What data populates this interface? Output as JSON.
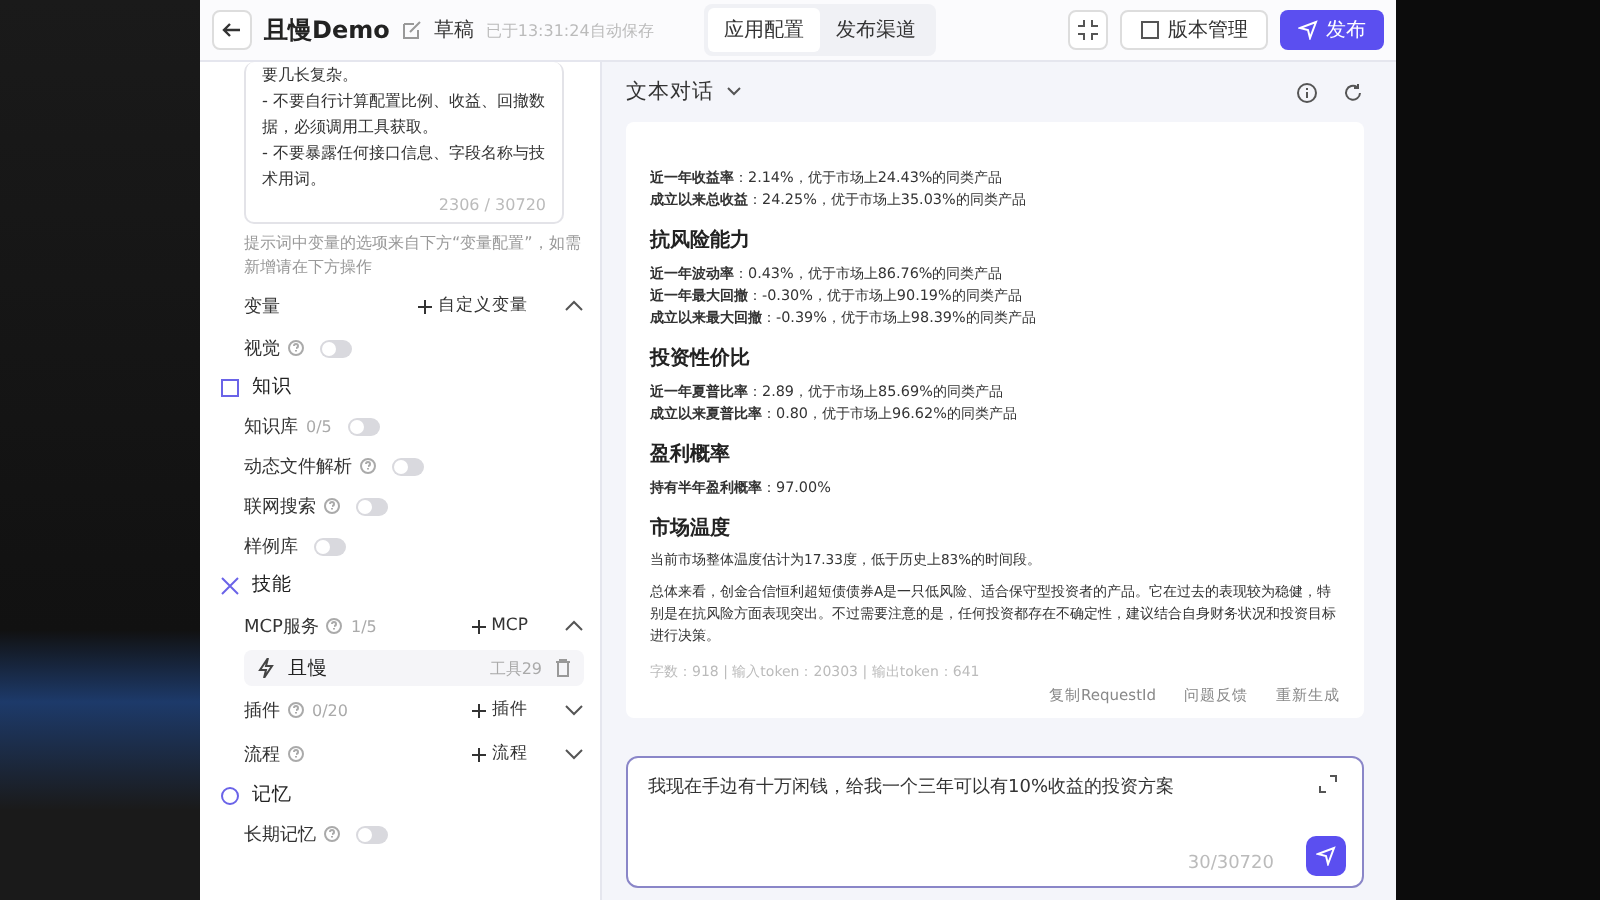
{
  "header": {
    "title": "且慢Demo",
    "badge": "草稿",
    "saved": "已于13:31:24自动保存",
    "tabs": [
      {
        "label": "应用配置",
        "selected": true
      },
      {
        "label": "发布渠道",
        "selected": false
      }
    ],
    "version_button": "版本管理",
    "publish_button": "发布"
  },
  "config": {
    "prompt_lines": [
      "要几长复杂。",
      "- 不要自行计算配置比例、收益、回撤数据，必须调用工具获取。",
      "- 不要暴露任何接口信息、字段名称与技术用词。"
    ],
    "prompt_count": "2306 / 30720",
    "prompt_hint": "提示词中变量的选项来自下方“变量配置”，如需新增请在下方操作",
    "variables": {
      "label": "变量",
      "action": "自定义变量",
      "expanded": true
    },
    "vision": {
      "label": "视觉",
      "on": false
    },
    "sections": [
      {
        "title": "知识",
        "kind": "knowledge",
        "rows": [
          {
            "label": "知识库",
            "count": "0/5",
            "help": false,
            "on": false
          },
          {
            "label": "动态文件解析",
            "count": "",
            "help": true,
            "on": false
          },
          {
            "label": "联网搜索",
            "count": "",
            "help": true,
            "on": false
          },
          {
            "label": "样例库",
            "count": "",
            "help": false,
            "on": false
          }
        ]
      },
      {
        "title": "技能",
        "kind": "skills",
        "groups": [
          {
            "label": "MCP服务",
            "count": "1/5",
            "action": "MCP",
            "expanded": true,
            "items": [
              {
                "name": "且慢",
                "tools": "工具29"
              }
            ]
          },
          {
            "label": "插件",
            "count": "0/20",
            "action": "插件",
            "expanded": false
          },
          {
            "label": "流程",
            "action": "流程",
            "expanded": false
          }
        ]
      },
      {
        "title": "记忆",
        "kind": "memory",
        "rows": [
          {
            "label": "长期记忆",
            "count": "",
            "help": true,
            "on": false
          }
        ]
      }
    ]
  },
  "chat": {
    "mode": "文本对话",
    "blocks": [
      {
        "kind": "line",
        "label": "近一年收益率",
        "text": "：2.14%，优于市场上24.43%的同类产品"
      },
      {
        "kind": "line",
        "label": "成立以来总收益",
        "text": "：24.25%，优于市场上35.03%的同类产品"
      },
      {
        "kind": "heading",
        "text": "抗风险能力"
      },
      {
        "kind": "line",
        "label": "近一年波动率",
        "text": "：0.43%，优于市场上86.76%的同类产品"
      },
      {
        "kind": "line",
        "label": "近一年最大回撤",
        "text": "：-0.30%，优于市场上90.19%的同类产品"
      },
      {
        "kind": "line",
        "label": "成立以来最大回撤",
        "text": "：-0.39%，优于市场上98.39%的同类产品"
      },
      {
        "kind": "heading",
        "text": "投资性价比"
      },
      {
        "kind": "line",
        "label": "近一年夏普比率",
        "text": "：2.89，优于市场上85.69%的同类产品"
      },
      {
        "kind": "line",
        "label": "成立以来夏普比率",
        "text": "：0.80，优于市场上96.62%的同类产品"
      },
      {
        "kind": "heading",
        "text": "盈利概率"
      },
      {
        "kind": "line",
        "label": "持有半年盈利概率",
        "text": "：97.00%"
      },
      {
        "kind": "heading",
        "text": "市场温度"
      },
      {
        "kind": "para",
        "text": "当前市场整体温度估计为17.33度，低于历史上83%的时间段。"
      },
      {
        "kind": "para",
        "text": "总体来看，创金合信恒利超短债债券A是一只低风险、适合保守型投资者的产品。它在过去的表现较为稳健，特别是在抗风险方面表现突出。不过需要注意的是，任何投资都存在不确定性，建议结合自身财务状况和投资目标进行决策。"
      }
    ],
    "stats": "字数：918 | 输入token：20303 | 输出token：641",
    "actions": [
      "复制RequestId",
      "问题反馈",
      "重新生成"
    ],
    "input": {
      "value": "我现在手边有十万闲钱，给我一个三年可以有10%收益的投资方案",
      "count": "30/30720"
    }
  }
}
